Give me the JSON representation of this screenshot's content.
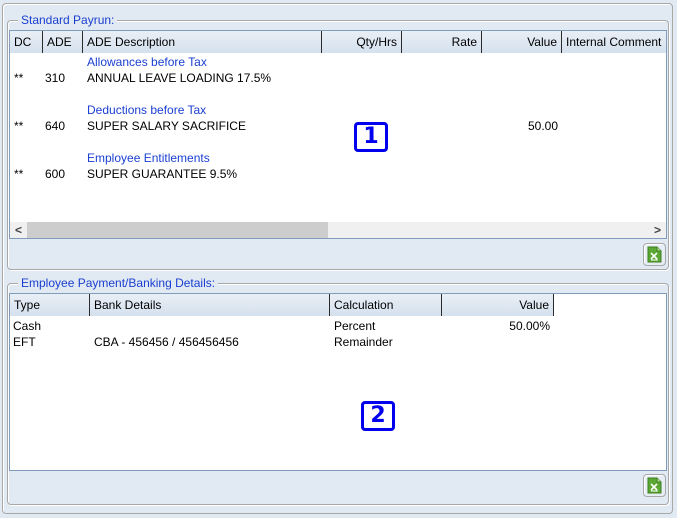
{
  "standard_payrun": {
    "legend": "Standard Payrun:",
    "columns": [
      {
        "label": "DC"
      },
      {
        "label": "ADE"
      },
      {
        "label": "ADE Description"
      },
      {
        "label": "Qty/Hrs"
      },
      {
        "label": "Rate"
      },
      {
        "label": "Value"
      },
      {
        "label": "Internal Comment"
      }
    ],
    "groups": [
      {
        "title": "Allowances before Tax",
        "rows": [
          {
            "dc": "**",
            "ade": "310",
            "description": "ANNUAL LEAVE LOADING 17.5%",
            "qty": "",
            "rate": "",
            "value": "",
            "comment": ""
          }
        ]
      },
      {
        "title": "Deductions before Tax",
        "rows": [
          {
            "dc": "**",
            "ade": "640",
            "description": "SUPER SALARY SACRIFICE",
            "qty": "",
            "rate": "",
            "value": "50.00",
            "comment": ""
          }
        ]
      },
      {
        "title": "Employee Entitlements",
        "rows": [
          {
            "dc": "**",
            "ade": "600",
            "description": "SUPER GUARANTEE 9.5%",
            "qty": "",
            "rate": "",
            "value": "",
            "comment": ""
          }
        ]
      }
    ],
    "scroll_left_glyph": "<",
    "scroll_right_glyph": ">",
    "export_icon": "excel-export-icon",
    "marker": "1"
  },
  "banking": {
    "legend": "Employee Payment/Banking Details:",
    "columns": [
      {
        "label": "Type"
      },
      {
        "label": "Bank Details"
      },
      {
        "label": "Calculation"
      },
      {
        "label": "Value"
      }
    ],
    "rows": [
      {
        "type": "Cash",
        "bank_details": "",
        "calculation": "Percent",
        "value": "50.00%"
      },
      {
        "type": "EFT",
        "bank_details": "CBA - 456456 / 456456456",
        "calculation": "Remainder",
        "value": ""
      }
    ],
    "export_icon": "excel-export-icon",
    "marker": "2"
  },
  "colors": {
    "legend_text": "#1a3fd1",
    "group_title": "#1a3fd1",
    "marker": "#0000ee",
    "panel_bg": "#e1e9f2",
    "excel_green": "#5aa832"
  }
}
